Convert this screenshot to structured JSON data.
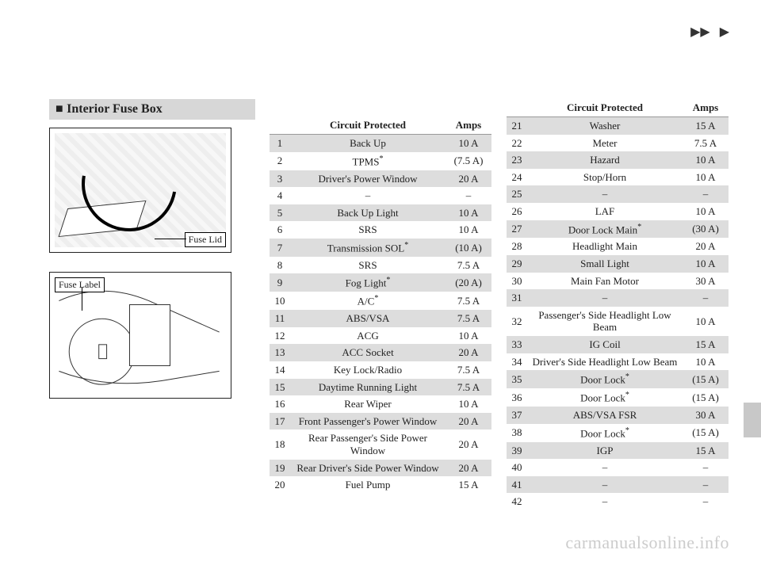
{
  "nav": {
    "ffwd": "▶▶",
    "play": "▶"
  },
  "section_title": "Interior Fuse Box",
  "diagram1": {
    "callout": "Fuse Lid"
  },
  "diagram2": {
    "callout": "Fuse Label"
  },
  "headers": {
    "circuit": "Circuit Protected",
    "amps": "Amps"
  },
  "table_left": [
    {
      "n": "1",
      "c": "Back Up",
      "a": "10 A"
    },
    {
      "n": "2",
      "c": "TPMS*",
      "a": "(7.5 A)"
    },
    {
      "n": "3",
      "c": "Driver's Power Window",
      "a": "20 A"
    },
    {
      "n": "4",
      "c": "–",
      "a": "–"
    },
    {
      "n": "5",
      "c": "Back Up Light",
      "a": "10 A"
    },
    {
      "n": "6",
      "c": "SRS",
      "a": "10 A"
    },
    {
      "n": "7",
      "c": "Transmission SOL*",
      "a": "(10 A)"
    },
    {
      "n": "8",
      "c": "SRS",
      "a": "7.5 A"
    },
    {
      "n": "9",
      "c": "Fog Light*",
      "a": "(20 A)"
    },
    {
      "n": "10",
      "c": "A/C*",
      "a": "7.5 A"
    },
    {
      "n": "11",
      "c": "ABS/VSA",
      "a": "7.5 A"
    },
    {
      "n": "12",
      "c": "ACG",
      "a": "10 A"
    },
    {
      "n": "13",
      "c": "ACC Socket",
      "a": "20 A"
    },
    {
      "n": "14",
      "c": "Key Lock/Radio",
      "a": "7.5 A"
    },
    {
      "n": "15",
      "c": "Daytime Running Light",
      "a": "7.5 A"
    },
    {
      "n": "16",
      "c": "Rear Wiper",
      "a": "10 A"
    },
    {
      "n": "17",
      "c": "Front Passenger's Power Window",
      "a": "20 A"
    },
    {
      "n": "18",
      "c": "Rear Passenger's Side Power Window",
      "a": "20 A"
    },
    {
      "n": "19",
      "c": "Rear Driver's Side Power Window",
      "a": "20 A"
    },
    {
      "n": "20",
      "c": "Fuel Pump",
      "a": "15 A"
    }
  ],
  "table_right": [
    {
      "n": "21",
      "c": "Washer",
      "a": "15 A"
    },
    {
      "n": "22",
      "c": "Meter",
      "a": "7.5 A"
    },
    {
      "n": "23",
      "c": "Hazard",
      "a": "10 A"
    },
    {
      "n": "24",
      "c": "Stop/Horn",
      "a": "10 A"
    },
    {
      "n": "25",
      "c": "–",
      "a": "–"
    },
    {
      "n": "26",
      "c": "LAF",
      "a": "10 A"
    },
    {
      "n": "27",
      "c": "Door Lock Main*",
      "a": "(30 A)"
    },
    {
      "n": "28",
      "c": "Headlight Main",
      "a": "20 A"
    },
    {
      "n": "29",
      "c": "Small Light",
      "a": "10 A"
    },
    {
      "n": "30",
      "c": "Main Fan Motor",
      "a": "30 A"
    },
    {
      "n": "31",
      "c": "–",
      "a": "–"
    },
    {
      "n": "32",
      "c": "Passenger's Side Headlight Low Beam",
      "a": "10 A"
    },
    {
      "n": "33",
      "c": "IG Coil",
      "a": "15 A"
    },
    {
      "n": "34",
      "c": "Driver's Side Headlight Low Beam",
      "a": "10 A"
    },
    {
      "n": "35",
      "c": "Door Lock*",
      "a": "(15 A)"
    },
    {
      "n": "36",
      "c": "Door Lock*",
      "a": "(15 A)"
    },
    {
      "n": "37",
      "c": "ABS/VSA FSR",
      "a": "30 A"
    },
    {
      "n": "38",
      "c": "Door Lock*",
      "a": "(15 A)"
    },
    {
      "n": "39",
      "c": "IGP",
      "a": "15 A"
    },
    {
      "n": "40",
      "c": "–",
      "a": "–"
    },
    {
      "n": "41",
      "c": "–",
      "a": "–"
    },
    {
      "n": "42",
      "c": "–",
      "a": "–"
    }
  ],
  "watermark": "carmanualsonline.info"
}
